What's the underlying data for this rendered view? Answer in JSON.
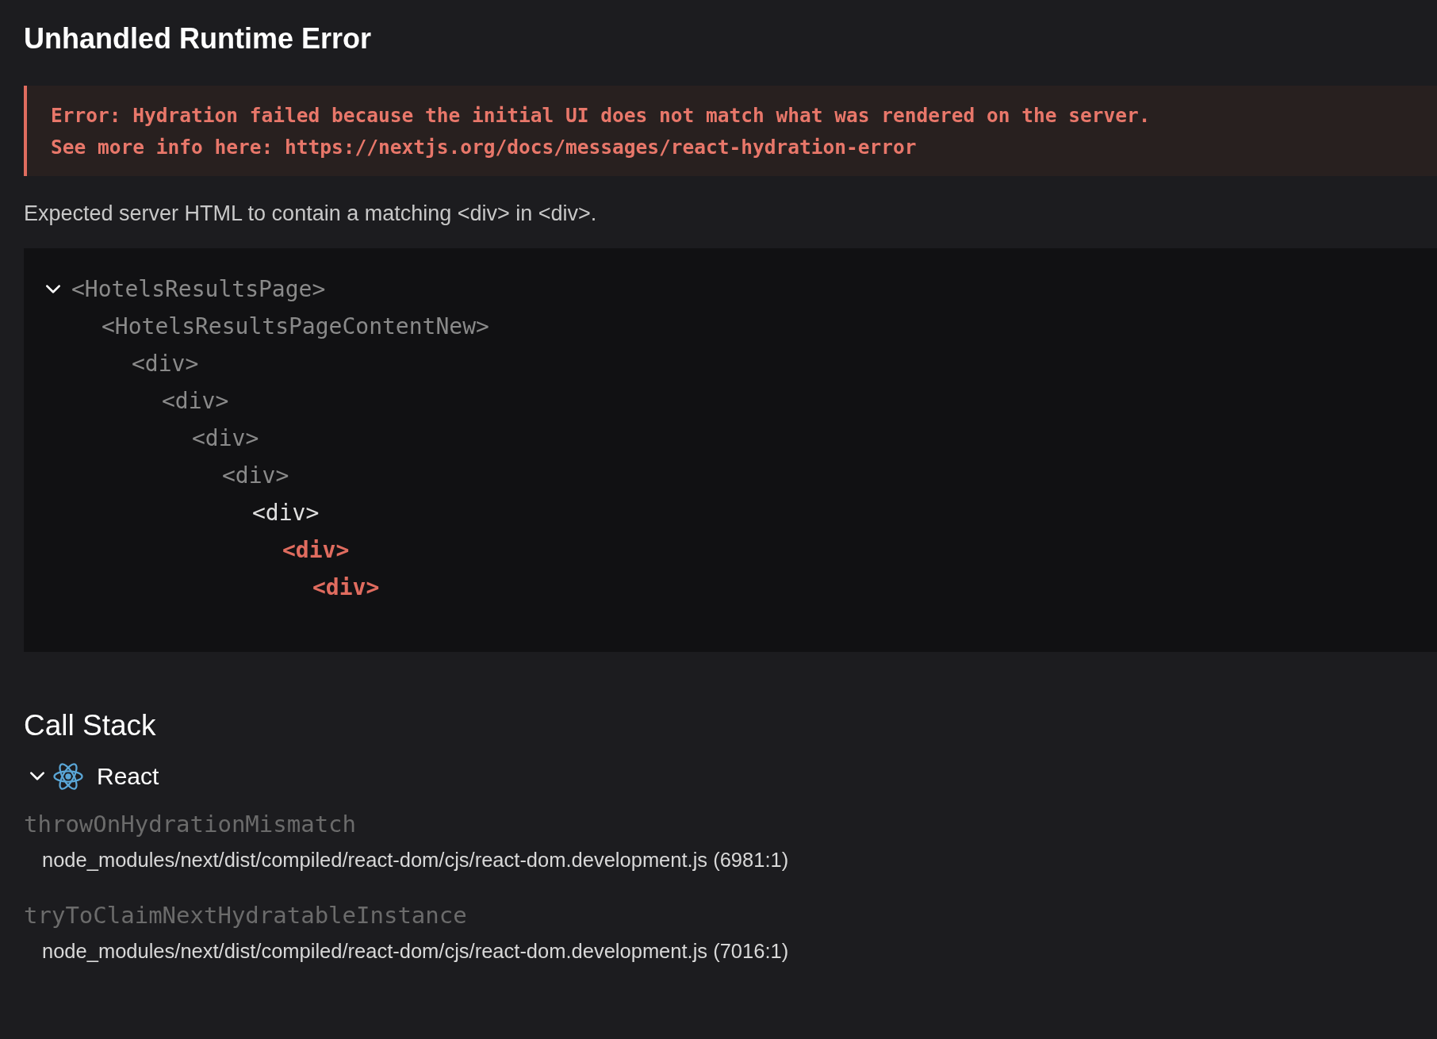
{
  "title": "Unhandled Runtime Error",
  "error": {
    "lines": [
      "Error: Hydration failed because the initial UI does not match what was rendered on the server.",
      "See more info here: https://nextjs.org/docs/messages/react-hydration-error"
    ]
  },
  "description": "Expected server HTML to contain a matching <div> in <div>.",
  "component_tree": {
    "nodes": [
      {
        "label": "<HotelsResultsPage>",
        "kind": "dim",
        "expanded": true,
        "children": [
          {
            "label": "<HotelsResultsPageContentNew>",
            "kind": "dim",
            "children": [
              {
                "label": "<div>",
                "kind": "dim",
                "children": [
                  {
                    "label": "<div>",
                    "kind": "dim",
                    "children": [
                      {
                        "label": "<div>",
                        "kind": "dim",
                        "children": [
                          {
                            "label": "<div>",
                            "kind": "dim",
                            "children": [
                              {
                                "label": "<div>",
                                "kind": "plain",
                                "children": [
                                  {
                                    "label": "<div>",
                                    "kind": "mismatch",
                                    "children": [
                                      {
                                        "label": "<div>",
                                        "kind": "mismatch"
                                      }
                                    ]
                                  }
                                ]
                              }
                            ]
                          }
                        ]
                      }
                    ]
                  }
                ]
              }
            ]
          }
        ]
      }
    ]
  },
  "call_stack": {
    "heading": "Call Stack",
    "groups": [
      {
        "name": "React",
        "expanded": true,
        "frames": [
          {
            "function": "throwOnHydrationMismatch",
            "location": "node_modules/next/dist/compiled/react-dom/cjs/react-dom.development.js (6981:1)"
          },
          {
            "function": "tryToClaimNextHydratableInstance",
            "location": "node_modules/next/dist/compiled/react-dom/cjs/react-dom.development.js (7016:1)"
          }
        ]
      }
    ]
  }
}
